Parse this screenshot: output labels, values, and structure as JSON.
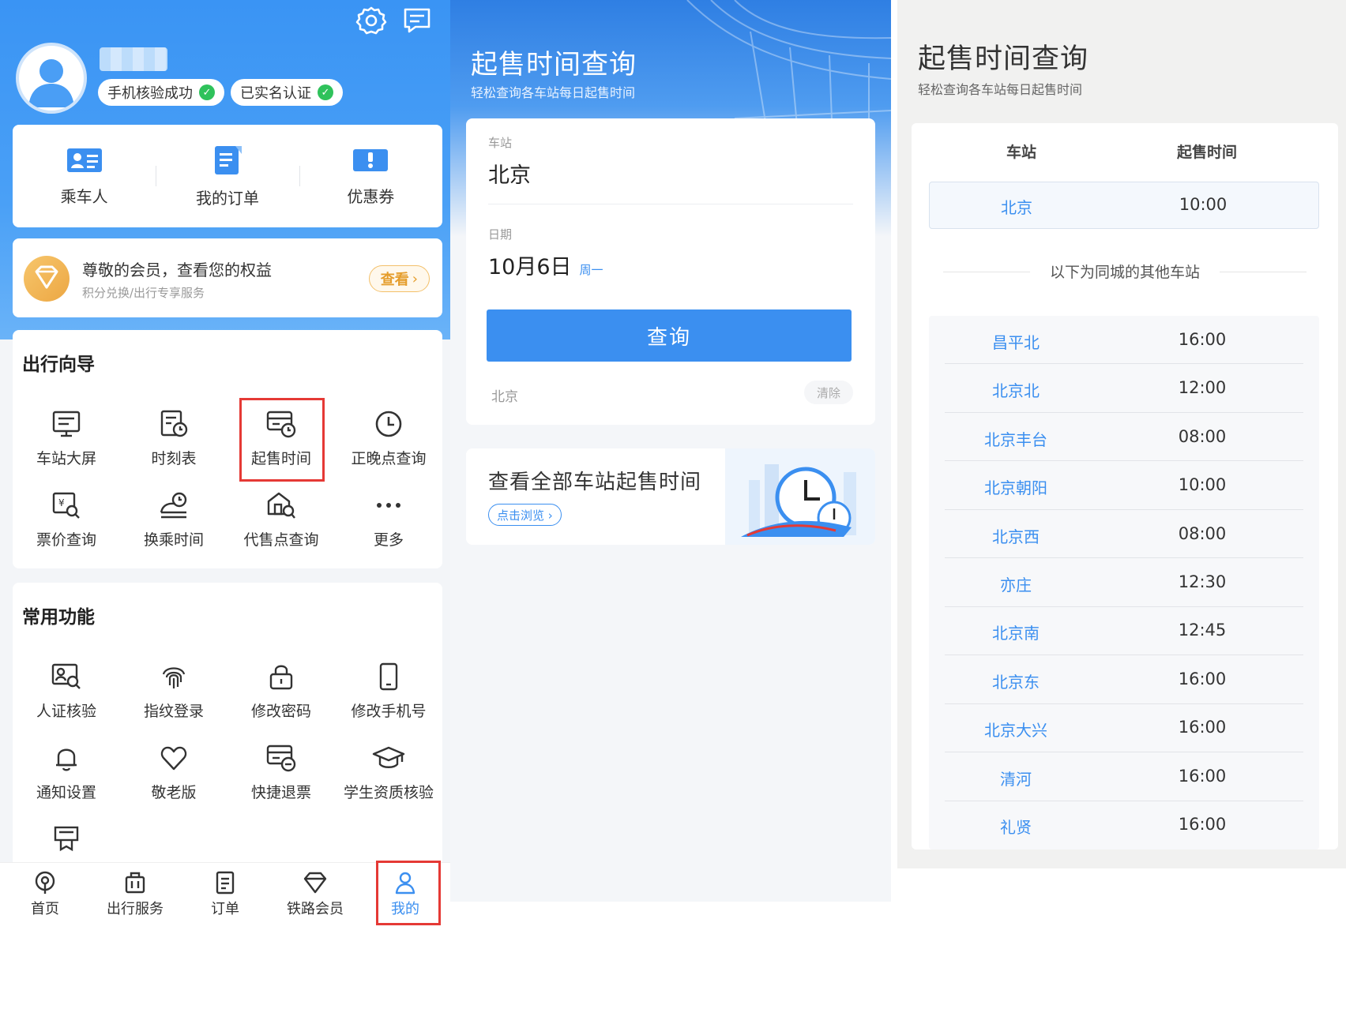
{
  "profile": {
    "phone_badge": "手机核验成功",
    "verified_badge": "已实名认证"
  },
  "quick_actions": [
    {
      "label": "乘车人",
      "icon": "passenger-card-icon"
    },
    {
      "label": "我的订单",
      "icon": "order-list-icon"
    },
    {
      "label": "优惠券",
      "icon": "coupon-icon"
    }
  ],
  "member": {
    "title": "尊敬的会员，查看您的权益",
    "subtitle": "积分兑换/出行专享服务",
    "button": "查看"
  },
  "guide": {
    "title": "出行向导",
    "items": [
      {
        "label": "车站大屏",
        "icon": "station-screen-icon"
      },
      {
        "label": "时刻表",
        "icon": "timetable-icon"
      },
      {
        "label": "起售时间",
        "icon": "sale-time-icon"
      },
      {
        "label": "正晚点查询",
        "icon": "clock-icon"
      },
      {
        "label": "票价查询",
        "icon": "fare-search-icon"
      },
      {
        "label": "换乘时间",
        "icon": "transfer-time-icon"
      },
      {
        "label": "代售点查询",
        "icon": "agency-search-icon"
      },
      {
        "label": "更多",
        "icon": "more-icon"
      }
    ]
  },
  "common": {
    "title": "常用功能",
    "items": [
      {
        "label": "人证核验",
        "icon": "id-verify-icon"
      },
      {
        "label": "指纹登录",
        "icon": "fingerprint-icon"
      },
      {
        "label": "修改密码",
        "icon": "lock-icon"
      },
      {
        "label": "修改手机号",
        "icon": "phone-icon"
      },
      {
        "label": "通知设置",
        "icon": "bell-icon"
      },
      {
        "label": "敬老版",
        "icon": "heart-icon"
      },
      {
        "label": "快捷退票",
        "icon": "refund-ticket-icon"
      },
      {
        "label": "学生资质核验",
        "icon": "graduation-cap-icon"
      }
    ]
  },
  "bottom_nav": [
    {
      "label": "首页",
      "icon": "home-train-icon"
    },
    {
      "label": "出行服务",
      "icon": "luggage-icon"
    },
    {
      "label": "订单",
      "icon": "order-icon"
    },
    {
      "label": "铁路会员",
      "icon": "diamond-icon"
    },
    {
      "label": "我的",
      "icon": "user-icon",
      "active": true
    }
  ],
  "query_page": {
    "title": "起售时间查询",
    "subtitle": "轻松查询各车站每日起售时间",
    "station_label": "车站",
    "station_value": "北京",
    "date_label": "日期",
    "date_value": "10月6日",
    "weekday": "周一",
    "query_button": "查询",
    "history_item": "北京",
    "clear_button": "清除",
    "all_title": "查看全部车站起售时间",
    "browse_button": "点击浏览 ›"
  },
  "result_page": {
    "title": "起售时间查询",
    "subtitle": "轻松查询各车站每日起售时间",
    "col_station": "车站",
    "col_time": "起售时间",
    "main": {
      "station": "北京",
      "time": "10:00"
    },
    "other_label": "以下为同城的其他车站",
    "others": [
      {
        "station": "昌平北",
        "time": "16:00"
      },
      {
        "station": "北京北",
        "time": "12:00"
      },
      {
        "station": "北京丰台",
        "time": "08:00"
      },
      {
        "station": "北京朝阳",
        "time": "10:00"
      },
      {
        "station": "北京西",
        "time": "08:00"
      },
      {
        "station": "亦庄",
        "time": "12:30"
      },
      {
        "station": "北京南",
        "time": "12:45"
      },
      {
        "station": "北京东",
        "time": "16:00"
      },
      {
        "station": "北京大兴",
        "time": "16:00"
      },
      {
        "station": "清河",
        "time": "16:00"
      },
      {
        "station": "礼贤",
        "time": "16:00"
      }
    ]
  },
  "colors": {
    "primary": "#3b8ff0",
    "highlight": "#e53935",
    "gold": "#eca743"
  }
}
